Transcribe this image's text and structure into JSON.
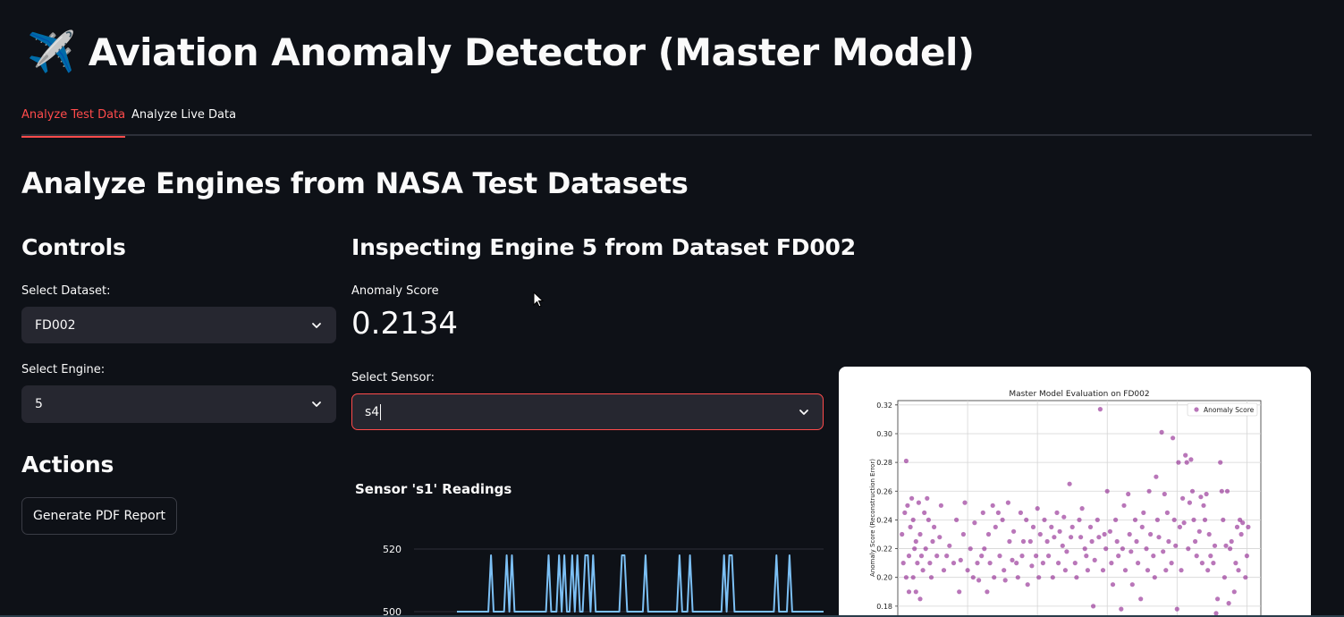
{
  "header": {
    "icon": "✈️",
    "title": "Aviation Anomaly Detector (Master Model)"
  },
  "tabs": [
    {
      "label": "Analyze Test Data",
      "active": true
    },
    {
      "label": "Analyze Live Data",
      "active": false
    }
  ],
  "page_heading": "Analyze Engines from NASA Test Datasets",
  "controls": {
    "heading": "Controls",
    "dataset_label": "Select Dataset:",
    "dataset_value": "FD002",
    "engine_label": "Select Engine:",
    "engine_value": "5"
  },
  "actions": {
    "heading": "Actions",
    "generate_pdf_label": "Generate PDF Report"
  },
  "inspect": {
    "heading": "Inspecting Engine 5 from Dataset FD002",
    "metric_label": "Anomaly Score",
    "metric_value": "0.2134",
    "sensor_label": "Select Sensor:",
    "sensor_value": "s4"
  },
  "colors": {
    "accent": "#ff4b4b",
    "background": "#0e1117",
    "widget": "#262730",
    "line": "#7cc0f5",
    "scatter": "#8b1a8b"
  },
  "chart_data": [
    {
      "type": "line",
      "title": "Sensor 's1' Readings",
      "yticks": [
        "520",
        "500"
      ],
      "ylim": [
        500,
        520
      ],
      "values": [
        500,
        500,
        500,
        500,
        500,
        500,
        500,
        500,
        500,
        500,
        500,
        500,
        500,
        518,
        500,
        500,
        500,
        500,
        500,
        518,
        500,
        518,
        500,
        500,
        500,
        500,
        500,
        500,
        500,
        500,
        500,
        500,
        500,
        500,
        500,
        518,
        500,
        500,
        500,
        518,
        500,
        518,
        500,
        500,
        518,
        500,
        518,
        500,
        500,
        518,
        518,
        500,
        518,
        500,
        500,
        500,
        500,
        500,
        500,
        500,
        500,
        500,
        500,
        518,
        518,
        500,
        500,
        500,
        500,
        500,
        500,
        500,
        518,
        500,
        500,
        500,
        500,
        500,
        500,
        500,
        500,
        500,
        500,
        500,
        500,
        518,
        500,
        500,
        500,
        518,
        500,
        500,
        500,
        500,
        500,
        500,
        500,
        500,
        500,
        500,
        500,
        500,
        518,
        500,
        518,
        518,
        500,
        500,
        500,
        500,
        500,
        500,
        500,
        500,
        500,
        500,
        500,
        500,
        500,
        500,
        500,
        500,
        518,
        500,
        500,
        500,
        500,
        518,
        500,
        500,
        500,
        500,
        500,
        500,
        500,
        500,
        500,
        500,
        500,
        500,
        500
      ]
    },
    {
      "type": "scatter",
      "title": "Master Model Evaluation on FD002",
      "ylabel": "Anomaly Score (Reconstruction Error)",
      "legend": "Anomaly Score",
      "legend_position": "top-right",
      "yticks": [
        "0.32",
        "0.30",
        "0.28",
        "0.26",
        "0.24",
        "0.22",
        "0.20",
        "0.18"
      ],
      "ylim": [
        0.16,
        0.323
      ],
      "xlim": [
        0,
        260
      ],
      "grid": true,
      "points": [
        [
          3,
          0.23
        ],
        [
          4,
          0.21
        ],
        [
          5,
          0.245
        ],
        [
          6,
          0.2
        ],
        [
          6,
          0.281
        ],
        [
          7,
          0.25
        ],
        [
          8,
          0.19
        ],
        [
          8,
          0.215
        ],
        [
          9,
          0.235
        ],
        [
          9,
          0.168
        ],
        [
          10,
          0.255
        ],
        [
          11,
          0.24
        ],
        [
          11,
          0.2
        ],
        [
          12,
          0.22
        ],
        [
          13,
          0.225
        ],
        [
          13,
          0.19
        ],
        [
          14,
          0.21
        ],
        [
          15,
          0.252
        ],
        [
          16,
          0.23
        ],
        [
          16,
          0.185
        ],
        [
          17,
          0.215
        ],
        [
          18,
          0.205
        ],
        [
          19,
          0.245
        ],
        [
          20,
          0.22
        ],
        [
          21,
          0.255
        ],
        [
          22,
          0.24
        ],
        [
          23,
          0.21
        ],
        [
          24,
          0.2
        ],
        [
          25,
          0.225
        ],
        [
          26,
          0.235
        ],
        [
          28,
          0.215
        ],
        [
          30,
          0.228
        ],
        [
          31,
          0.25
        ],
        [
          33,
          0.205
        ],
        [
          35,
          0.215
        ],
        [
          37,
          0.222
        ],
        [
          40,
          0.21
        ],
        [
          42,
          0.24
        ],
        [
          44,
          0.19
        ],
        [
          45,
          0.212
        ],
        [
          47,
          0.23
        ],
        [
          48,
          0.252
        ],
        [
          50,
          0.205
        ],
        [
          52,
          0.22
        ],
        [
          54,
          0.2
        ],
        [
          55,
          0.238
        ],
        [
          57,
          0.21
        ],
        [
          58,
          0.198
        ],
        [
          60,
          0.215
        ],
        [
          61,
          0.245
        ],
        [
          62,
          0.22
        ],
        [
          64,
          0.19
        ],
        [
          65,
          0.23
        ],
        [
          66,
          0.21
        ],
        [
          68,
          0.25
        ],
        [
          69,
          0.2
        ],
        [
          70,
          0.235
        ],
        [
          72,
          0.245
        ],
        [
          73,
          0.215
        ],
        [
          75,
          0.24
        ],
        [
          76,
          0.205
        ],
        [
          77,
          0.198
        ],
        [
          79,
          0.252
        ],
        [
          80,
          0.225
        ],
        [
          82,
          0.212
        ],
        [
          83,
          0.232
        ],
        [
          85,
          0.21
        ],
        [
          86,
          0.2
        ],
        [
          88,
          0.245
        ],
        [
          89,
          0.215
        ],
        [
          90,
          0.225
        ],
        [
          92,
          0.24
        ],
        [
          93,
          0.195
        ],
        [
          95,
          0.225
        ],
        [
          96,
          0.208
        ],
        [
          97,
          0.235
        ],
        [
          99,
          0.215
        ],
        [
          100,
          0.248
        ],
        [
          101,
          0.2
        ],
        [
          102,
          0.23
        ],
        [
          104,
          0.21
        ],
        [
          105,
          0.24
        ],
        [
          107,
          0.225
        ],
        [
          108,
          0.215
        ],
        [
          110,
          0.235
        ],
        [
          111,
          0.2
        ],
        [
          112,
          0.228
        ],
        [
          114,
          0.245
        ],
        [
          115,
          0.21
        ],
        [
          116,
          0.232
        ],
        [
          118,
          0.222
        ],
        [
          119,
          0.242
        ],
        [
          120,
          0.205
        ],
        [
          121,
          0.218
        ],
        [
          123,
          0.265
        ],
        [
          124,
          0.228
        ],
        [
          125,
          0.235
        ],
        [
          127,
          0.21
        ],
        [
          128,
          0.2
        ],
        [
          130,
          0.24
        ],
        [
          131,
          0.228
        ],
        [
          132,
          0.248
        ],
        [
          134,
          0.22
        ],
        [
          135,
          0.215
        ],
        [
          136,
          0.205
        ],
        [
          138,
          0.235
        ],
        [
          139,
          0.225
        ],
        [
          140,
          0.18
        ],
        [
          141,
          0.212
        ],
        [
          143,
          0.24
        ],
        [
          144,
          0.228
        ],
        [
          145,
          0.317
        ],
        [
          147,
          0.205
        ],
        [
          148,
          0.23
        ],
        [
          149,
          0.22
        ],
        [
          150,
          0.26
        ],
        [
          152,
          0.232
        ],
        [
          153,
          0.21
        ],
        [
          154,
          0.195
        ],
        [
          156,
          0.24
        ],
        [
          157,
          0.225
        ],
        [
          158,
          0.215
        ],
        [
          160,
          0.178
        ],
        [
          161,
          0.22
        ],
        [
          162,
          0.25
        ],
        [
          163,
          0.205
        ],
        [
          165,
          0.258
        ],
        [
          166,
          0.23
        ],
        [
          167,
          0.218
        ],
        [
          168,
          0.195
        ],
        [
          170,
          0.24
        ],
        [
          171,
          0.225
        ],
        [
          172,
          0.21
        ],
        [
          174,
          0.185
        ],
        [
          175,
          0.235
        ],
        [
          176,
          0.245
        ],
        [
          178,
          0.22
        ],
        [
          179,
          0.205
        ],
        [
          180,
          0.26
        ],
        [
          181,
          0.23
        ],
        [
          183,
          0.215
        ],
        [
          184,
          0.2
        ],
        [
          185,
          0.27
        ],
        [
          186,
          0.24
        ],
        [
          187,
          0.228
        ],
        [
          189,
          0.301
        ],
        [
          190,
          0.218
        ],
        [
          191,
          0.258
        ],
        [
          192,
          0.205
        ],
        [
          193,
          0.245
        ],
        [
          194,
          0.225
        ],
        [
          196,
          0.21
        ],
        [
          197,
          0.297
        ],
        [
          198,
          0.24
        ],
        [
          199,
          0.222
        ],
        [
          200,
          0.178
        ],
        [
          201,
          0.28
        ],
        [
          202,
          0.235
        ],
        [
          203,
          0.205
        ],
        [
          204,
          0.255
        ],
        [
          205,
          0.238
        ],
        [
          206,
          0.285
        ],
        [
          207,
          0.28
        ],
        [
          208,
          0.22
        ],
        [
          209,
          0.252
        ],
        [
          210,
          0.282
        ],
        [
          211,
          0.26
        ],
        [
          212,
          0.24
        ],
        [
          213,
          0.225
        ],
        [
          214,
          0.215
        ],
        [
          216,
          0.232
        ],
        [
          217,
          0.256
        ],
        [
          218,
          0.21
        ],
        [
          219,
          0.25
        ],
        [
          220,
          0.24
        ],
        [
          221,
          0.258
        ],
        [
          222,
          0.205
        ],
        [
          223,
          0.23
        ],
        [
          224,
          0.215
        ],
        [
          226,
          0.21
        ],
        [
          227,
          0.222
        ],
        [
          228,
          0.175
        ],
        [
          229,
          0.185
        ],
        [
          231,
          0.28
        ],
        [
          232,
          0.26
        ],
        [
          233,
          0.24
        ],
        [
          234,
          0.2
        ],
        [
          235,
          0.222
        ],
        [
          236,
          0.26
        ],
        [
          237,
          0.182
        ],
        [
          238,
          0.22
        ],
        [
          239,
          0.225
        ],
        [
          241,
          0.19
        ],
        [
          242,
          0.21
        ],
        [
          243,
          0.235
        ],
        [
          244,
          0.205
        ],
        [
          245,
          0.24
        ],
        [
          246,
          0.23
        ],
        [
          247,
          0.238
        ],
        [
          249,
          0.2
        ],
        [
          250,
          0.215
        ],
        [
          251,
          0.235
        ]
      ]
    }
  ]
}
